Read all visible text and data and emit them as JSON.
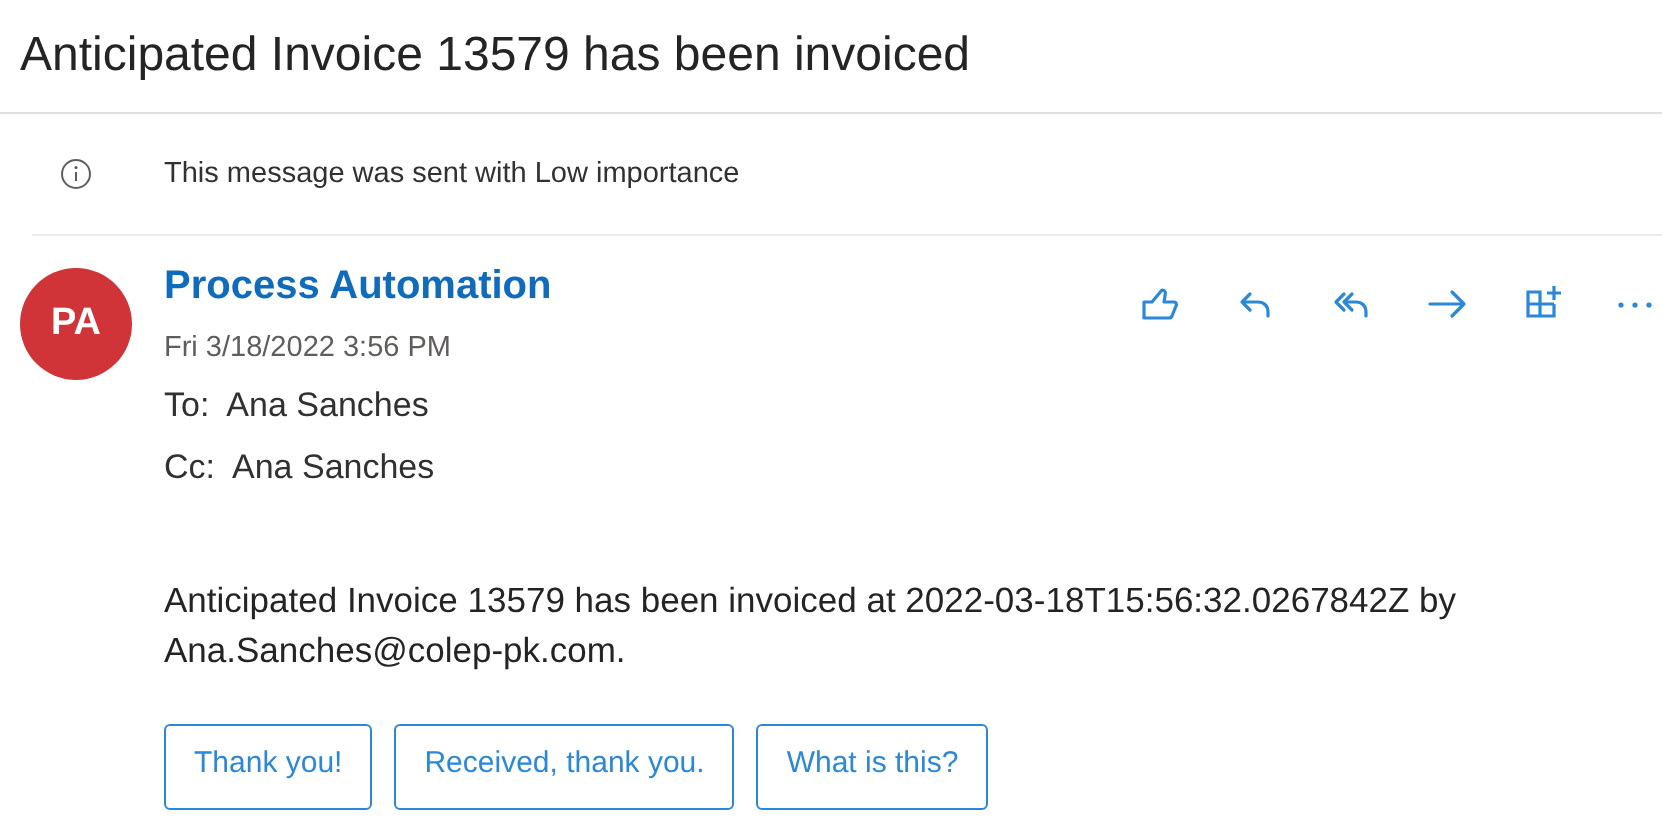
{
  "subject": "Anticipated Invoice 13579 has been invoiced",
  "notice": "This message was sent with Low importance",
  "sender": {
    "initials": "PA",
    "name": "Process Automation",
    "date": "Fri 3/18/2022 3:56 PM",
    "color": "#d13438"
  },
  "recipients": [
    {
      "label": "To:",
      "name": "Ana Sanches"
    },
    {
      "label": "Cc:",
      "name": "Ana Sanches"
    }
  ],
  "actions": [
    {
      "kind": "like"
    },
    {
      "kind": "reply"
    },
    {
      "kind": "reply_all"
    },
    {
      "kind": "forward"
    },
    {
      "kind": "apps"
    },
    {
      "kind": "more"
    }
  ],
  "body": "Anticipated Invoice 13579 has been invoiced at 2022-03-18T15:56:32.0267842Z by Ana.Sanches@colep-pk.com.",
  "quick_replies": [
    "Thank you!",
    "Received, thank you.",
    "What is this?"
  ]
}
